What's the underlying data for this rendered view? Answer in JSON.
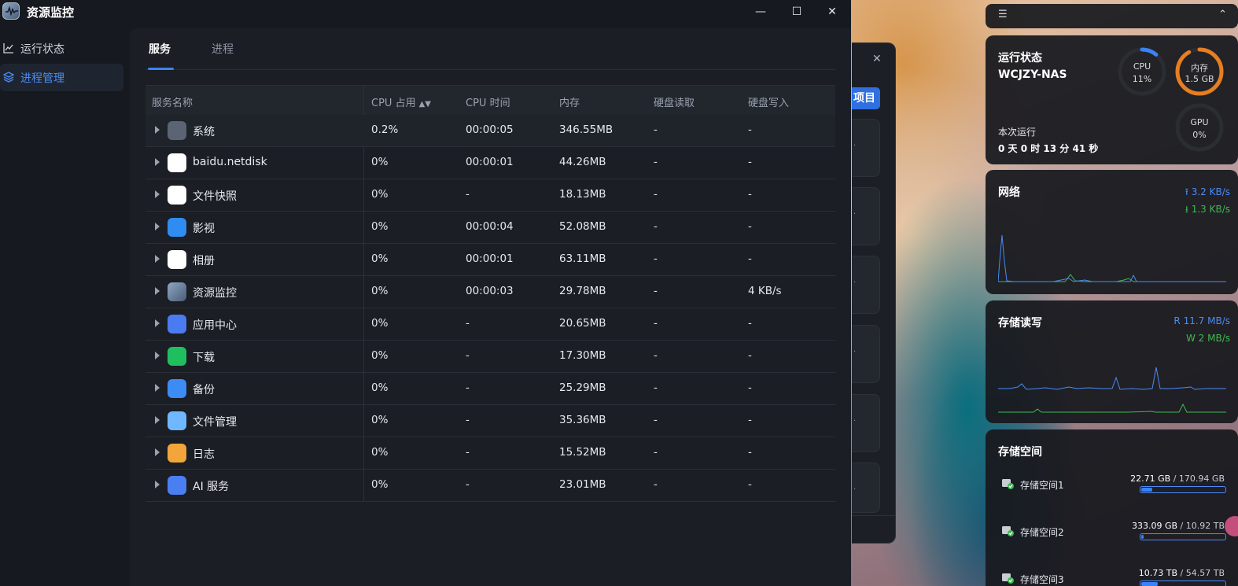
{
  "app": {
    "title": "资源监控"
  },
  "window": {
    "minimize": "—",
    "maximize": "☐",
    "close": "✕"
  },
  "sidebar": {
    "items": [
      {
        "label": "运行状态"
      },
      {
        "label": "进程管理"
      }
    ]
  },
  "tabs": [
    {
      "label": "服务"
    },
    {
      "label": "进程"
    }
  ],
  "table": {
    "headers": [
      "服务名称",
      "CPU 占用",
      "CPU 时间",
      "内存",
      "硬盘读取",
      "硬盘写入"
    ],
    "sort_indicator": "▲▼",
    "rows": [
      {
        "icon": "gear-icon",
        "name": "系统",
        "cpu": "0.2%",
        "time": "00:00:05",
        "mem": "346.55MB",
        "read": "-",
        "write": "-"
      },
      {
        "icon": "baidu-netdisk-icon",
        "name": "baidu.netdisk",
        "cpu": "0%",
        "time": "00:00:01",
        "mem": "44.26MB",
        "read": "-",
        "write": "-"
      },
      {
        "icon": "file-snapshot-icon",
        "name": "文件快照",
        "cpu": "0%",
        "time": "-",
        "mem": "18.13MB",
        "read": "-",
        "write": "-"
      },
      {
        "icon": "video-icon",
        "name": "影视",
        "cpu": "0%",
        "time": "00:00:04",
        "mem": "52.08MB",
        "read": "-",
        "write": "-"
      },
      {
        "icon": "photos-icon",
        "name": "相册",
        "cpu": "0%",
        "time": "00:00:01",
        "mem": "63.11MB",
        "read": "-",
        "write": "-"
      },
      {
        "icon": "resource-monitor-icon",
        "name": "资源监控",
        "cpu": "0%",
        "time": "00:00:03",
        "mem": "29.78MB",
        "read": "-",
        "write": "4 KB/s"
      },
      {
        "icon": "app-store-icon",
        "name": "应用中心",
        "cpu": "0%",
        "time": "-",
        "mem": "20.65MB",
        "read": "-",
        "write": "-"
      },
      {
        "icon": "download-icon",
        "name": "下载",
        "cpu": "0%",
        "time": "-",
        "mem": "17.30MB",
        "read": "-",
        "write": "-"
      },
      {
        "icon": "backup-icon",
        "name": "备份",
        "cpu": "0%",
        "time": "-",
        "mem": "25.29MB",
        "read": "-",
        "write": "-"
      },
      {
        "icon": "folder-icon",
        "name": "文件管理",
        "cpu": "0%",
        "time": "-",
        "mem": "35.36MB",
        "read": "-",
        "write": "-"
      },
      {
        "icon": "log-icon",
        "name": "日志",
        "cpu": "0%",
        "time": "-",
        "mem": "15.52MB",
        "read": "-",
        "write": "-"
      },
      {
        "icon": "ai-icon",
        "name": "AI 服务",
        "cpu": "0%",
        "time": "-",
        "mem": "23.01MB",
        "read": "-",
        "write": "-"
      }
    ]
  },
  "dialog": {
    "close": "✕",
    "button_fragment": "项目",
    "card_dots": [
      "·",
      "·",
      "·",
      "·",
      "·",
      "·"
    ]
  },
  "widgets": {
    "toolbar": {
      "left_icon": "☰",
      "right_icon": "⌃"
    },
    "status": {
      "title": "运行状态",
      "host": "WCJZY-NAS",
      "uptime_label": "本次运行",
      "uptime": "0 天 0 时 13 分 41 秒",
      "cpu": {
        "label": "CPU",
        "value": "11%",
        "fraction": 0.11
      },
      "mem": {
        "label": "内存",
        "value": "1.5 GB",
        "fraction": 0.92
      },
      "gpu": {
        "label": "GPU",
        "value": "0%",
        "fraction": 0
      }
    },
    "network": {
      "title": "网络",
      "up": "⭱ 3.2 KB/s",
      "down": "⭳ 1.3 KB/s"
    },
    "storage_io": {
      "title": "存储读写",
      "read": "R  11.7 MB/s",
      "write": "W    2 MB/s"
    },
    "storage": {
      "title": "存储空间",
      "disks": [
        {
          "name": "存储空间1",
          "used": "22.71 GB",
          "total": " / 170.94 GB",
          "fraction": 0.13
        },
        {
          "name": "存储空间2",
          "used": "333.09 GB",
          "total": " / 10.92 TB",
          "fraction": 0.03
        },
        {
          "name": "存储空间3",
          "used": "10.73 TB",
          "total": " / 54.57 TB",
          "fraction": 0.2
        }
      ]
    }
  },
  "colors": {
    "accent": "#3b82f6",
    "mem_ring": "#e67e22",
    "upload": "#4b8bf5",
    "download": "#3fb950"
  }
}
